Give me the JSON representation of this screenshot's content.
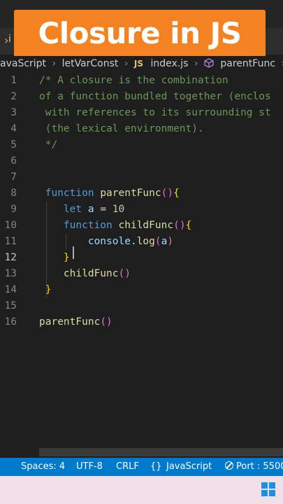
{
  "banner": {
    "title": "Closure in JS"
  },
  "tab": {
    "label": "i"
  },
  "breadcrumb": {
    "items": [
      "avaScript",
      "letVarConst",
      "index.js",
      "parentFunc"
    ],
    "file_badge": "JS"
  },
  "editor": {
    "line_numbers": [
      "1",
      "2",
      "3",
      "4",
      "5",
      "6",
      "7",
      "8",
      "9",
      "10",
      "11",
      "12",
      "13",
      "14",
      "15",
      "16"
    ],
    "active_line": "12",
    "lines": [
      "/* A closure is the combination",
      "of a function bundled together (enclos",
      " with references to its surrounding st",
      " (the lexical environment).",
      " */",
      "",
      "",
      " function parentFunc(){",
      "    let a = 10",
      "    function childFunc(){",
      "        console.log(a)",
      "    }",
      "    childFunc()",
      " }",
      "",
      "parentFunc()"
    ]
  },
  "statusbar": {
    "spaces": "Spaces: 4",
    "encoding": "UTF-8",
    "eol": "CRLF",
    "language": "JavaScript",
    "language_icon": "{}",
    "port": "Port : 5500"
  },
  "colors": {
    "banner_bg": "#f58220",
    "statusbar_bg": "#007acc",
    "editor_bg": "#1e1e1e",
    "comment": "#6a9955",
    "keyword": "#569cd6",
    "function": "#dcdcaa"
  },
  "icons": [
    "file-js-icon",
    "cube-icon",
    "braces-icon",
    "port-icon",
    "windows-icon"
  ]
}
